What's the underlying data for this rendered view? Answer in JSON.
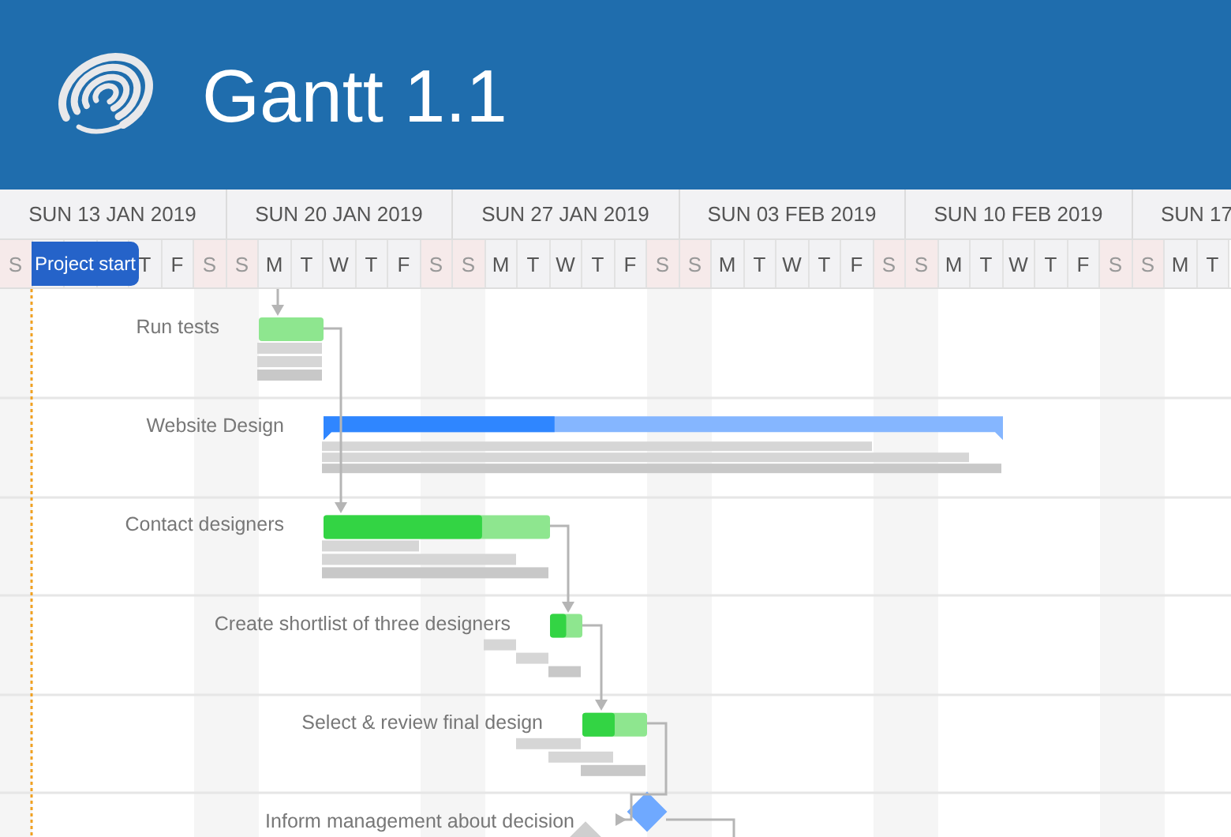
{
  "title": "Gantt 1.1",
  "weeks": [
    {
      "label": "SUN 13 JAN 2019"
    },
    {
      "label": "SUN 20 JAN 2019"
    },
    {
      "label": "SUN 27 JAN 2019"
    },
    {
      "label": "SUN 03 FEB 2019"
    },
    {
      "label": "SUN 10 FEB 2019"
    },
    {
      "label": "SUN 17"
    }
  ],
  "days": [
    {
      "label": "S",
      "weekend": true
    },
    {
      "label": "T",
      "weekend": false
    },
    {
      "label": "F",
      "weekend": false
    },
    {
      "label": "S",
      "weekend": true
    },
    {
      "label": "S",
      "weekend": true
    },
    {
      "label": "M",
      "weekend": false
    },
    {
      "label": "T",
      "weekend": false
    },
    {
      "label": "W",
      "weekend": false
    },
    {
      "label": "T",
      "weekend": false
    },
    {
      "label": "F",
      "weekend": false
    },
    {
      "label": "S",
      "weekend": true
    },
    {
      "label": "S",
      "weekend": true
    },
    {
      "label": "M",
      "weekend": false
    },
    {
      "label": "T",
      "weekend": false
    },
    {
      "label": "W",
      "weekend": false
    },
    {
      "label": "T",
      "weekend": false
    },
    {
      "label": "F",
      "weekend": false
    },
    {
      "label": "S",
      "weekend": true
    },
    {
      "label": "S",
      "weekend": true
    },
    {
      "label": "M",
      "weekend": false
    },
    {
      "label": "T",
      "weekend": false
    },
    {
      "label": "W",
      "weekend": false
    },
    {
      "label": "T",
      "weekend": false
    },
    {
      "label": "F",
      "weekend": false
    },
    {
      "label": "S",
      "weekend": true
    },
    {
      "label": "S",
      "weekend": true
    },
    {
      "label": "M",
      "weekend": false
    },
    {
      "label": "T",
      "weekend": false
    },
    {
      "label": "W",
      "weekend": false
    },
    {
      "label": "T",
      "weekend": false
    },
    {
      "label": "F",
      "weekend": false
    },
    {
      "label": "S",
      "weekend": true
    },
    {
      "label": "S",
      "weekend": true
    },
    {
      "label": "M",
      "weekend": false
    },
    {
      "label": "T",
      "weekend": false
    }
  ],
  "marker": {
    "label": "Project start"
  },
  "tasks": [
    {
      "name": "Run tests",
      "kind": "task"
    },
    {
      "name": "Website Design",
      "kind": "summary",
      "level": 0.34
    },
    {
      "name": "Contact designers",
      "kind": "task",
      "level": 0.7
    },
    {
      "name": "Create shortlist of three designers",
      "kind": "task",
      "level": 0.5
    },
    {
      "name": "Select & review final design",
      "kind": "task",
      "level": 0.5
    },
    {
      "name": "Inform management about decision",
      "kind": "milestone"
    }
  ]
}
